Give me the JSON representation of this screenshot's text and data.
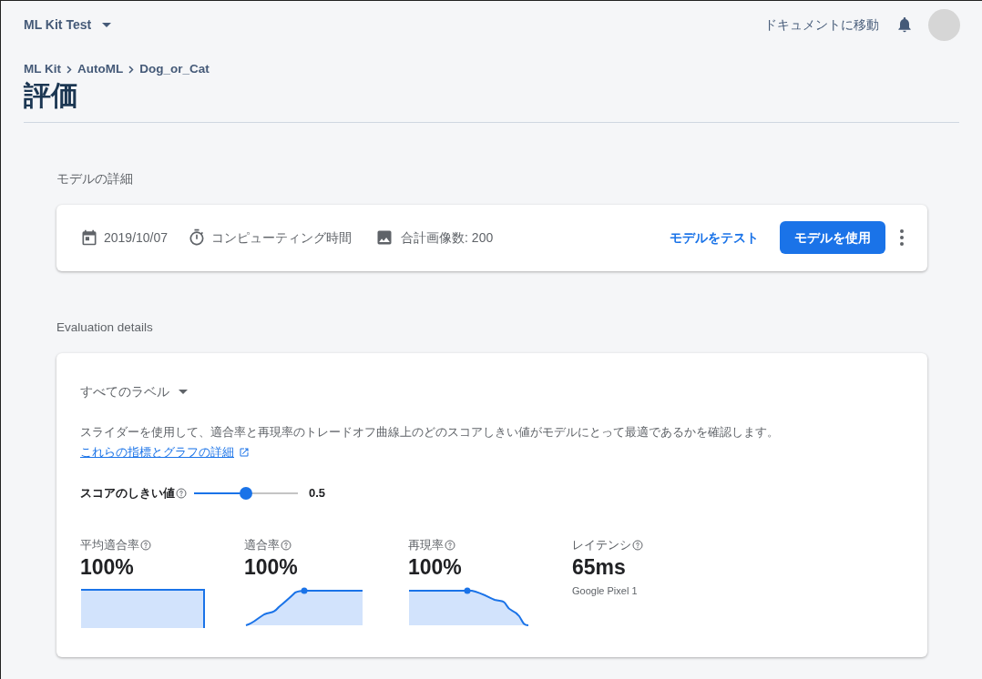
{
  "top_bar": {
    "project": "ML Kit Test",
    "docs_link": "ドキュメントに移動"
  },
  "breadcrumb": [
    "ML Kit",
    "AutoML",
    "Dog_or_Cat"
  ],
  "title": "評価",
  "model_details": {
    "label": "モデルの詳細",
    "date": "2019/10/07",
    "compute_time": "コンピューティング時間",
    "image_count": "合計画像数: 200",
    "test_button": "モデルをテスト",
    "use_button": "モデルを使用"
  },
  "evaluation": {
    "label": "Evaluation details",
    "label_filter": "すべてのラベル",
    "description": "スライダーを使用して、適合率と再現率のトレードオフ曲線上のどのスコアしきい値がモデルにとって最適であるかを確認します。",
    "details_link": "これらの指標とグラフの詳細",
    "threshold": {
      "label": "スコアのしきい値",
      "level": 0.5,
      "reading": "0.5"
    },
    "metrics": [
      {
        "kind": "step",
        "label": "平均適合率",
        "value": "100%"
      },
      {
        "kind": "rising",
        "label": "適合率",
        "value": "100%"
      },
      {
        "kind": "falling",
        "label": "再現率",
        "value": "100%"
      },
      {
        "kind": "plain",
        "label": "レイテンシ",
        "value": "65ms",
        "note": "Google Pixel 1"
      }
    ]
  }
}
